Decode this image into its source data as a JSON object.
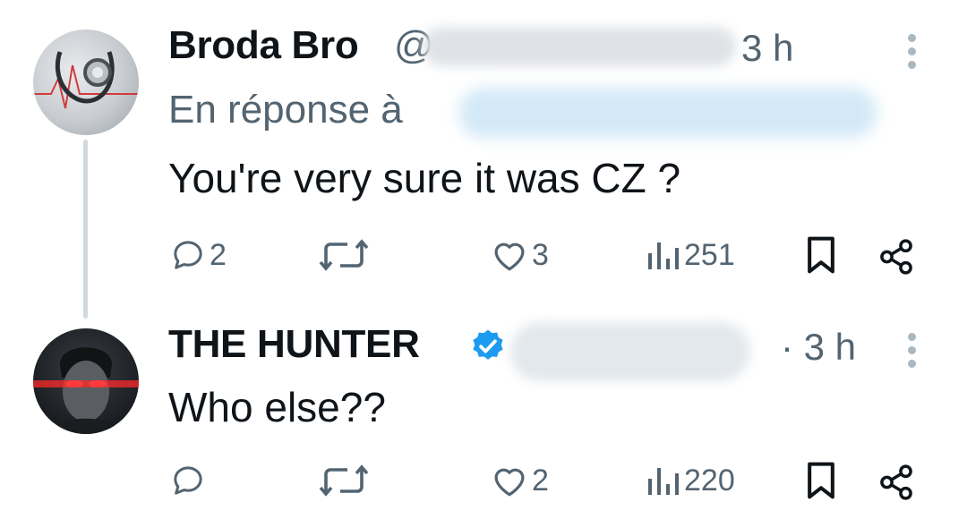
{
  "tweets": [
    {
      "author": "Broda Bro",
      "handle_partial": "@",
      "time": "3 h",
      "reply_prefix": "En réponse à",
      "text": "You're very sure it was CZ ?",
      "stats": {
        "replies": "2",
        "reposts": "",
        "likes": "3",
        "views": "251"
      }
    },
    {
      "author": "THE HUNTER",
      "verified": true,
      "time": "· 3 h",
      "text": "Who else??",
      "stats": {
        "replies": "",
        "reposts": "",
        "likes": "2",
        "views": "220"
      }
    }
  ],
  "colors": {
    "text": "#0f1419",
    "muted": "#536471",
    "verified": "#1d9bf0",
    "thread_line": "#cfd9de"
  },
  "icons": [
    "reply-icon",
    "repost-icon",
    "like-icon",
    "views-icon",
    "bookmark-icon",
    "share-icon",
    "more-icon",
    "verified-badge-icon"
  ]
}
